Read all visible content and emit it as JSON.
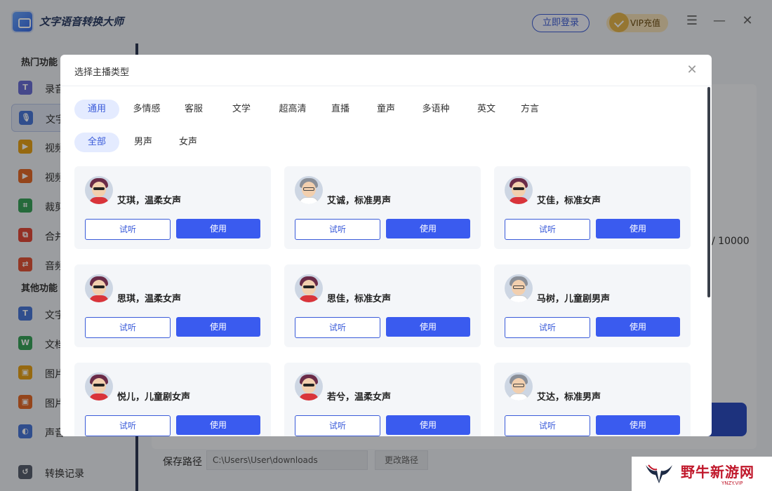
{
  "app": {
    "title": "文字语音转换大师",
    "login_label": "立即登录",
    "vip_label": "VIP充值",
    "menu_icon": "☰",
    "minimize_icon": "—",
    "close_icon": "✕"
  },
  "sidebar": {
    "section_hot": "热门功能",
    "section_other": "其他功能",
    "items": [
      {
        "label": "录音",
        "icon": "T",
        "color": "#6b6fd6"
      },
      {
        "label": "文字",
        "icon": "🎙",
        "color": "#4a78d9"
      },
      {
        "label": "视频",
        "icon": "▶",
        "color": "#e6a21a"
      },
      {
        "label": "视频",
        "icon": "▶",
        "color": "#e46a2a"
      },
      {
        "label": "裁剪",
        "icon": "⌗",
        "color": "#3aa35b"
      },
      {
        "label": "合并",
        "icon": "⧉",
        "color": "#e24a3a"
      },
      {
        "label": "音频",
        "icon": "⇄",
        "color": "#e2553a"
      },
      {
        "label": "文字",
        "icon": "T",
        "color": "#4a78d9"
      },
      {
        "label": "文档",
        "icon": "W",
        "color": "#3aa35b"
      },
      {
        "label": "图片",
        "icon": "▣",
        "color": "#e6a21a"
      },
      {
        "label": "图片",
        "icon": "▣",
        "color": "#e46a2a"
      },
      {
        "label": "声音",
        "icon": "◐",
        "color": "#4a78d9"
      }
    ],
    "history_label": "转换记录"
  },
  "main": {
    "count_text": "/ 10000",
    "save_label": "保存路径",
    "save_path": "C:\\Users\\User\\downloads",
    "change_path_label": "更改路径"
  },
  "modal": {
    "title": "选择主播类型",
    "close_icon": "✕",
    "categories": [
      "通用",
      "多情感",
      "客服",
      "文学",
      "超高清",
      "直播",
      "童声",
      "多语种",
      "英文",
      "方言"
    ],
    "genders": [
      "全部",
      "男声",
      "女声"
    ],
    "listen_label": "试听",
    "use_label": "使用",
    "voices": [
      {
        "name": "艾琪，温柔女声",
        "gender": "female"
      },
      {
        "name": "艾诚，标准男声",
        "gender": "male"
      },
      {
        "name": "艾佳，标准女声",
        "gender": "female"
      },
      {
        "name": "思琪，温柔女声",
        "gender": "female"
      },
      {
        "name": "思佳，标准女声",
        "gender": "female"
      },
      {
        "name": "马树，儿童剧男声",
        "gender": "male"
      },
      {
        "name": "悦儿，儿童剧女声",
        "gender": "female"
      },
      {
        "name": "若兮，温柔女声",
        "gender": "female"
      },
      {
        "name": "艾达，标准男声",
        "gender": "male"
      }
    ]
  },
  "watermark": {
    "text": "野牛新游网",
    "sub": "YNZY.VIP"
  }
}
